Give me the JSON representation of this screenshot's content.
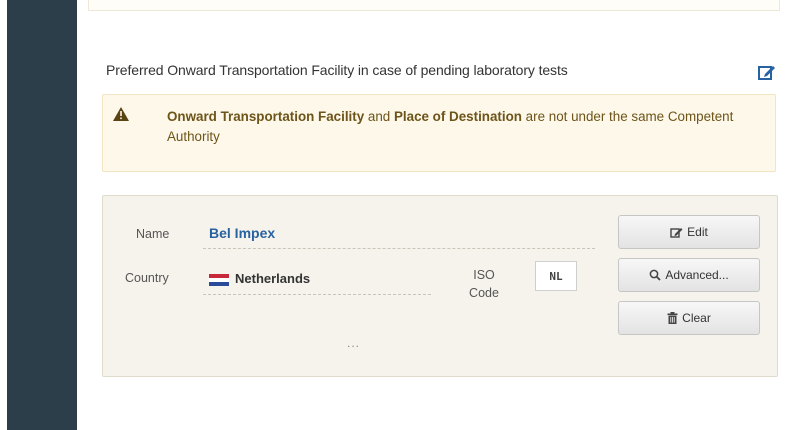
{
  "section": {
    "title": "Preferred Onward Transportation Facility in case of pending laboratory tests",
    "edit_icon": "edit-icon"
  },
  "warning": {
    "icon": "warning-triangle-icon",
    "text_bold": "Onward Transportation Facility",
    "text_mid": " and ",
    "text_bold2": "Place of Destination",
    "text_end": " are not under the same Competent Authority"
  },
  "facility": {
    "name_label": "Name",
    "name_value": "Bel Impex",
    "country_label": "Country",
    "country_value": "Netherlands",
    "country_flag": "netherlands-flag-icon",
    "iso_label": "ISO Code",
    "iso_value": "NL",
    "more": "..."
  },
  "buttons": {
    "edit": "Edit",
    "advanced": "Advanced...",
    "clear": "Clear"
  },
  "colors": {
    "sidebar": "#2c3e4a",
    "link_blue": "#2763a1",
    "warning_bg": "#fdf8ea",
    "warning_text": "#6d5418"
  }
}
